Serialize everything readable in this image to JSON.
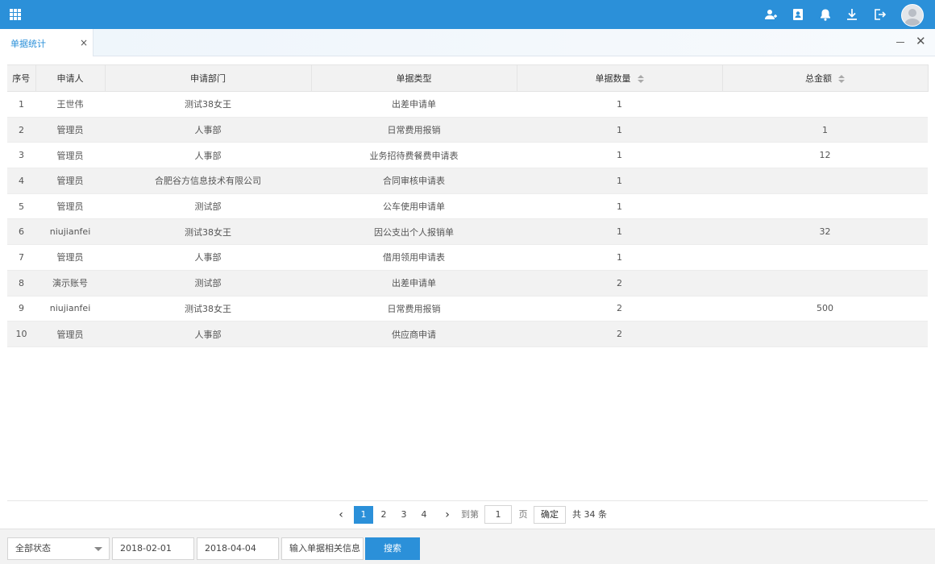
{
  "tab": {
    "label": "单据统计",
    "close": "×"
  },
  "window": {
    "close": "✕"
  },
  "table": {
    "headers": [
      "序号",
      "申请人",
      "申请部门",
      "单据类型",
      "单据数量",
      "总金额"
    ],
    "rows": [
      [
        "1",
        "王世伟",
        "测试38女王",
        "出差申请单",
        "1",
        ""
      ],
      [
        "2",
        "管理员",
        "人事部",
        "日常费用报销",
        "1",
        "1"
      ],
      [
        "3",
        "管理员",
        "人事部",
        "业务招待费餐费申请表",
        "1",
        "12"
      ],
      [
        "4",
        "管理员",
        "合肥谷方信息技术有限公司",
        "合同审核申请表",
        "1",
        ""
      ],
      [
        "5",
        "管理员",
        "测试部",
        "公车使用申请单",
        "1",
        ""
      ],
      [
        "6",
        "niujianfei",
        "测试38女王",
        "因公支出个人报销单",
        "1",
        "32"
      ],
      [
        "7",
        "管理员",
        "人事部",
        "借用领用申请表",
        "1",
        ""
      ],
      [
        "8",
        "演示账号",
        "测试部",
        "出差申请单",
        "2",
        ""
      ],
      [
        "9",
        "niujianfei",
        "测试38女王",
        "日常费用报销",
        "2",
        "500"
      ],
      [
        "10",
        "管理员",
        "人事部",
        "供应商申请",
        "2",
        ""
      ]
    ]
  },
  "pager": {
    "prev": "‹",
    "next": "›",
    "pages": [
      "1",
      "2",
      "3",
      "4"
    ],
    "goto_label": "到第",
    "goto_value": "1",
    "page_unit": "页",
    "confirm": "确定",
    "total": "共 34 条"
  },
  "filter": {
    "status": "全部状态",
    "date_from": "2018-02-01",
    "date_to": "2018-04-04",
    "keyword_placeholder": "输入单据相关信息",
    "search": "搜索"
  },
  "colors": {
    "accent": "#2b90d9"
  }
}
